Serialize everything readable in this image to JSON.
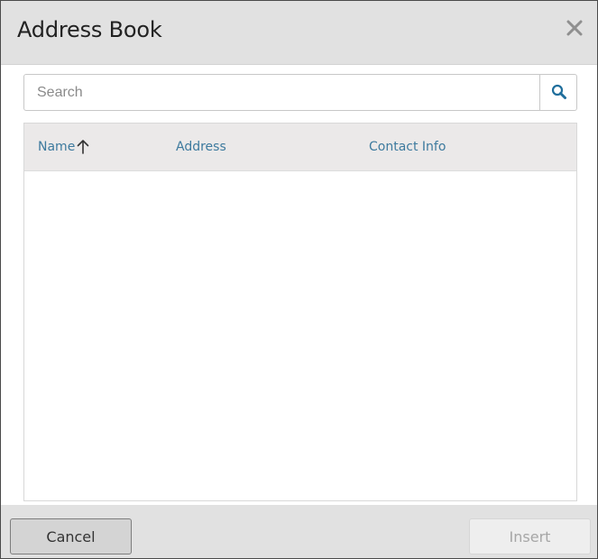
{
  "dialog": {
    "title": "Address Book",
    "close_icon": "close-icon"
  },
  "search": {
    "placeholder": "Search",
    "value": "",
    "icon": "search-icon"
  },
  "table": {
    "columns": [
      {
        "label": "Name",
        "sort": "ascending"
      },
      {
        "label": "Address"
      },
      {
        "label": "Contact Info"
      }
    ],
    "rows": []
  },
  "footer": {
    "cancel_label": "Cancel",
    "insert_label": "Insert"
  },
  "colors": {
    "header_bg": "#e1e1e1",
    "column_header_text": "#3d7a9e",
    "search_icon": "#1f6e9c",
    "disabled_text": "#a6a6a6"
  }
}
